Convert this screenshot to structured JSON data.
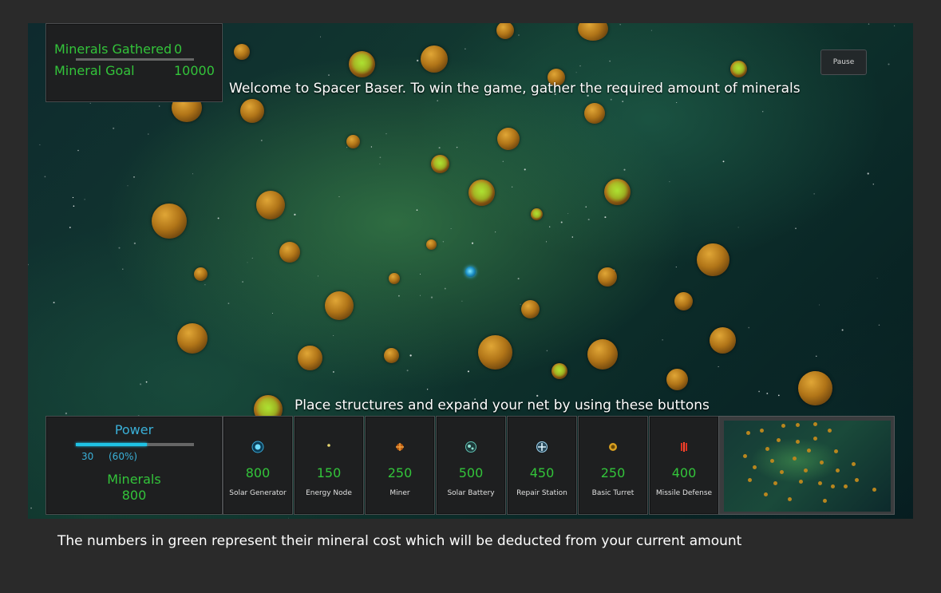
{
  "stats": {
    "minerals_gathered_label": "Minerals Gathered",
    "minerals_gathered_value": "0",
    "mineral_goal_label": "Mineral Goal",
    "mineral_goal_value": "10000"
  },
  "pause_label": "Pause",
  "messages": {
    "welcome": "Welcome to Spacer Baser.  To win the game, gather the required amount of minerals",
    "place": "Place structures and expand your net by using these buttons",
    "footer": "The numbers in green represent their mineral cost which will be deducted from your current amount"
  },
  "power": {
    "title": "Power",
    "value": "30",
    "percent_text": "(60%)",
    "fraction": 0.6
  },
  "minerals": {
    "label": "Minerals",
    "value": "800"
  },
  "structures": [
    {
      "name": "Solar Generator",
      "cost": "800",
      "icon": "solar-generator-icon",
      "color": "#2ab4e0"
    },
    {
      "name": "Energy Node",
      "cost": "150",
      "icon": "energy-node-icon",
      "color": "#e8d870"
    },
    {
      "name": "Miner",
      "cost": "250",
      "icon": "miner-icon",
      "color": "#e07a1a"
    },
    {
      "name": "Solar Battery",
      "cost": "500",
      "icon": "solar-battery-icon",
      "color": "#5fc0b0"
    },
    {
      "name": "Repair Station",
      "cost": "450",
      "icon": "repair-station-icon",
      "color": "#9fd4f0"
    },
    {
      "name": "Basic Turret",
      "cost": "250",
      "icon": "basic-turret-icon",
      "color": "#d9a020"
    },
    {
      "name": "Missile Defense",
      "cost": "400",
      "icon": "missile-defense-icon",
      "color": "#e03020"
    }
  ],
  "colors": {
    "mineral_green": "#33c43a",
    "power_cyan": "#1fc3e6",
    "panel_bg": "#1e1f20"
  }
}
